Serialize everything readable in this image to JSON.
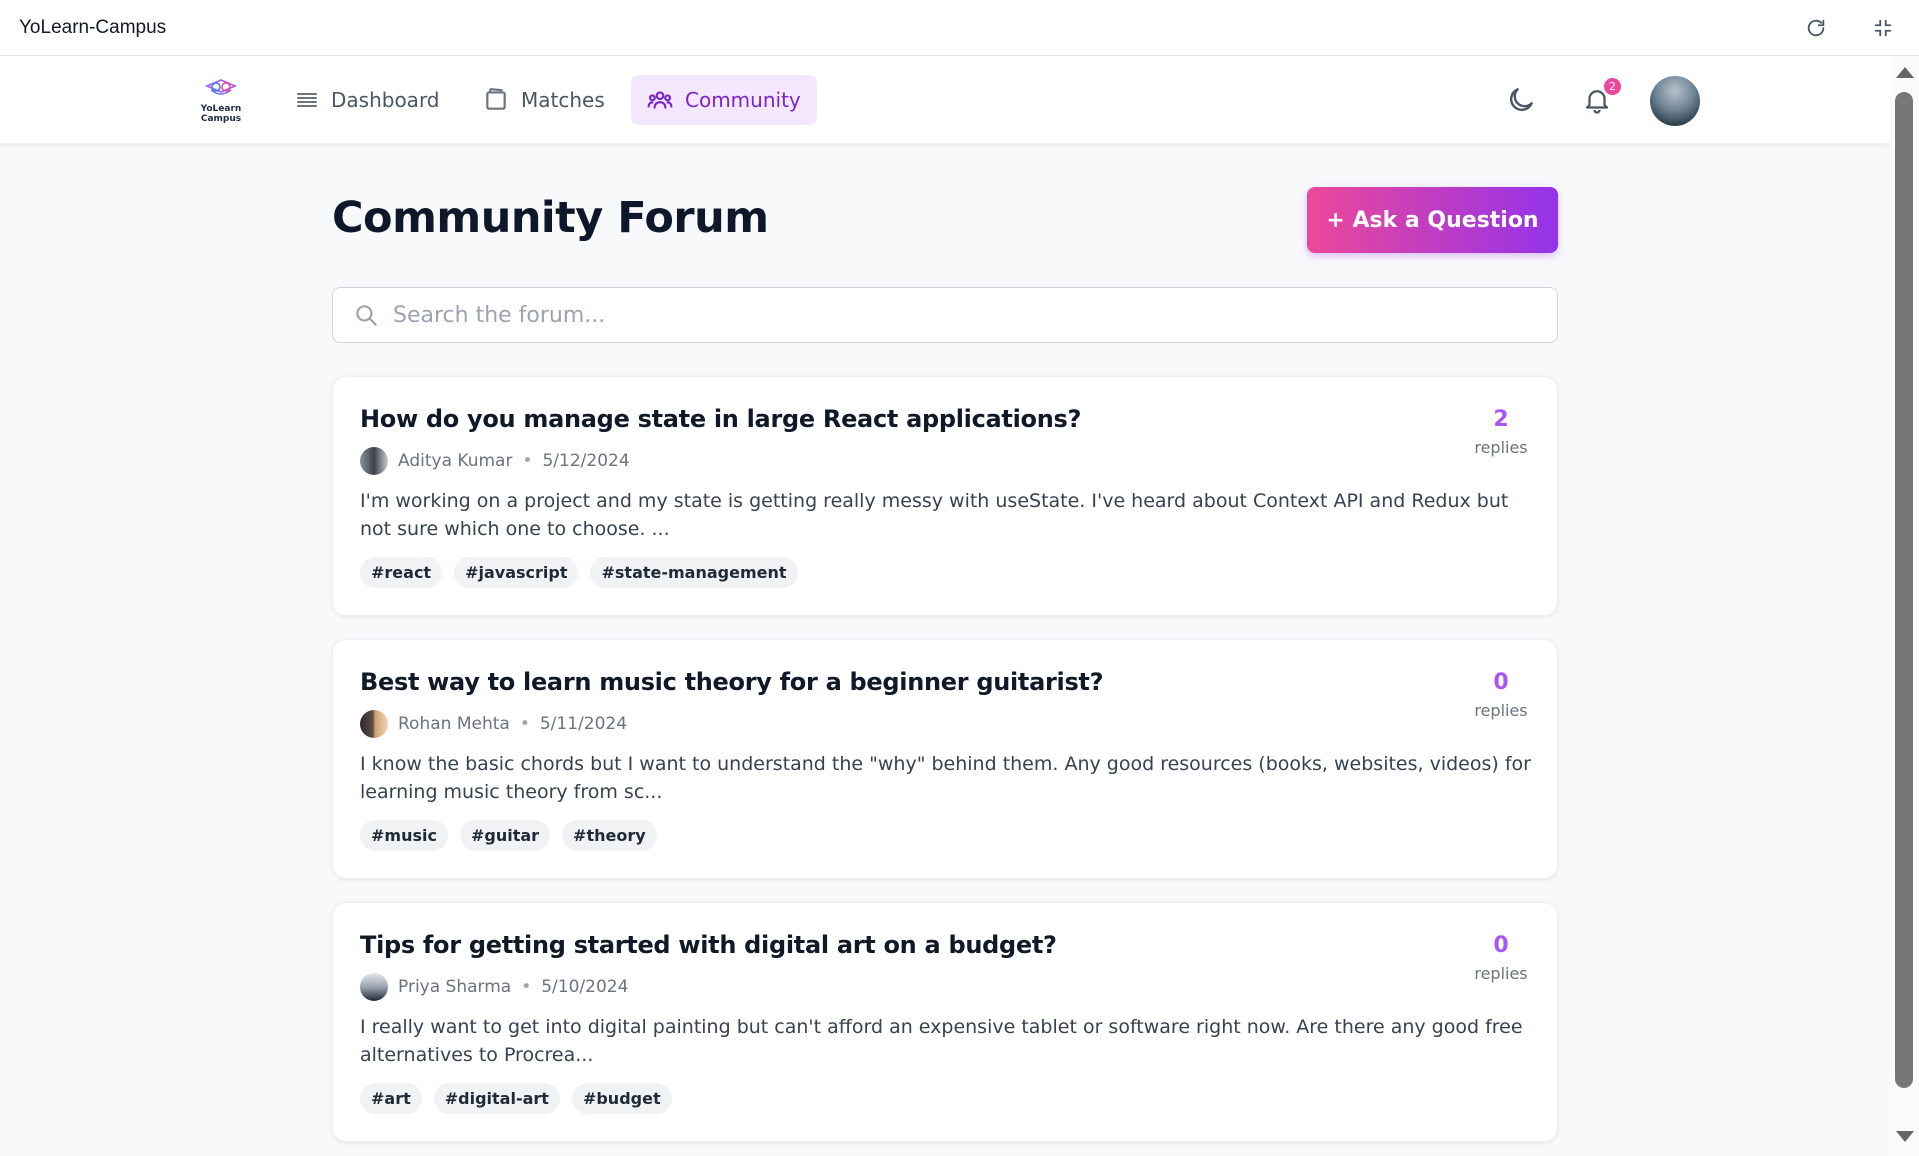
{
  "window": {
    "title": "YoLearn-Campus"
  },
  "nav": {
    "logo_line1": "YoLearn",
    "logo_line2": "Campus",
    "items": [
      {
        "label": "Dashboard",
        "icon": "list-icon"
      },
      {
        "label": "Matches",
        "icon": "book-icon"
      },
      {
        "label": "Community",
        "icon": "users-icon",
        "active": true
      }
    ],
    "notification_count": "2"
  },
  "page": {
    "title": "Community Forum",
    "ask_button": "+ Ask a Question",
    "search_placeholder": "Search the forum..."
  },
  "posts": [
    {
      "title": "How do you manage state in large React applications?",
      "author": "Aditya Kumar",
      "date": "5/12/2024",
      "excerpt": "I'm working on a project and my state is getting really messy with useState. I've heard about Context API and Redux but not sure which one to choose. ...",
      "tags": [
        "#react",
        "#javascript",
        "#state-management"
      ],
      "reply_count": "2",
      "reply_label": "replies"
    },
    {
      "title": "Best way to learn music theory for a beginner guitarist?",
      "author": "Rohan Mehta",
      "date": "5/11/2024",
      "excerpt": "I know the basic chords but I want to understand the \"why\" behind them. Any good resources (books, websites, videos) for learning music theory from sc...",
      "tags": [
        "#music",
        "#guitar",
        "#theory"
      ],
      "reply_count": "0",
      "reply_label": "replies"
    },
    {
      "title": "Tips for getting started with digital art on a budget?",
      "author": "Priya Sharma",
      "date": "5/10/2024",
      "excerpt": "I really want to get into digital painting but can't afford an expensive tablet or software right now. Are there any good free alternatives to Procrea...",
      "tags": [
        "#art",
        "#digital-art",
        "#budget"
      ],
      "reply_count": "0",
      "reply_label": "replies"
    }
  ],
  "colors": {
    "accent": "#9333ea",
    "accent_pink": "#ec4899",
    "reply_count": "#a855f7",
    "active_nav_bg": "#f3e8ff"
  }
}
